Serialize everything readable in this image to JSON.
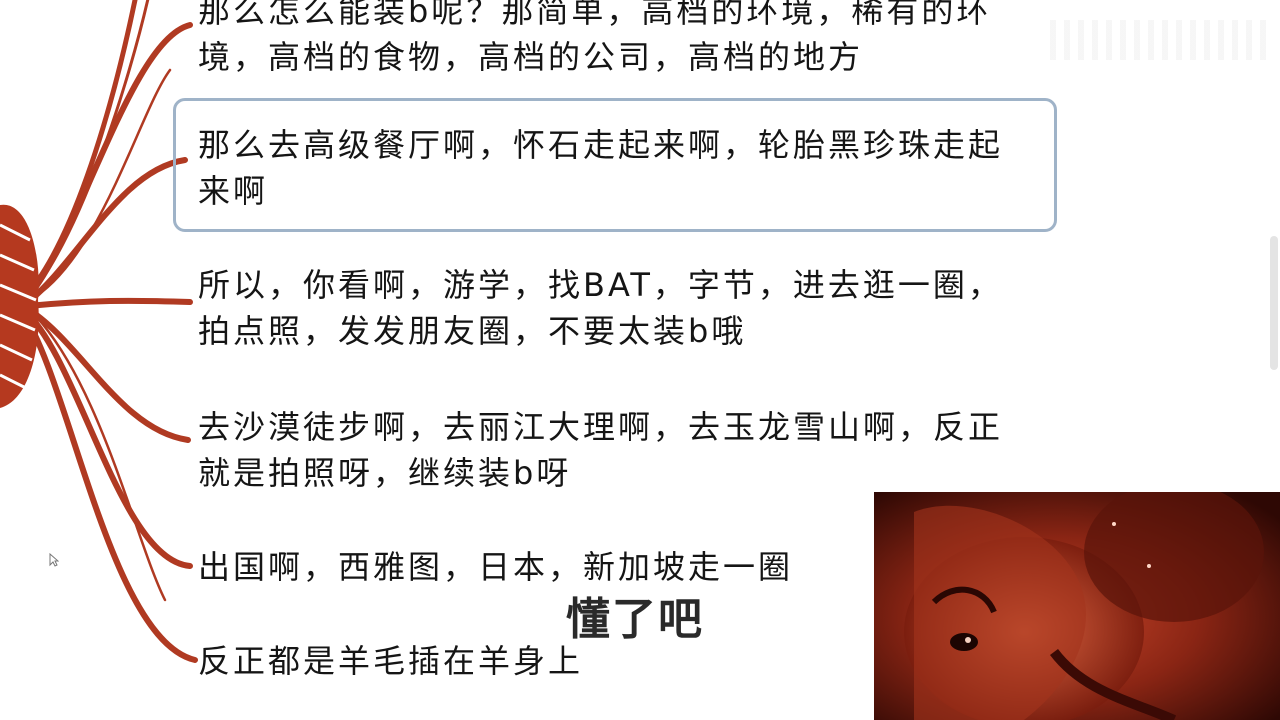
{
  "mindmap": {
    "branch_color": "#b03a22",
    "nodes": [
      {
        "text": "那么怎么能装b呢？那简单，高档的环境，稀有的环\n境，高档的食物，高档的公司，高档的地方"
      },
      {
        "text": "那么去高级餐厅啊，怀石走起来啊，轮胎黑珍珠走起\n来啊",
        "selected": true
      },
      {
        "text": "所以，你看啊，游学，找BAT，字节，进去逛一圈，\n拍点照，发发朋友圈，不要太装b哦"
      },
      {
        "text": "去沙漠徒步啊，去丽江大理啊，去玉龙雪山啊，反正\n就是拍照呀，继续装b呀"
      },
      {
        "text": "出国啊，西雅图，日本，新加坡走一圈"
      },
      {
        "text": "反正都是羊毛插在羊身上"
      }
    ]
  },
  "subtitle": {
    "text": "懂了吧"
  },
  "video_overlay": {
    "description_icon": "presenter-video-icon"
  },
  "colors": {
    "selection_border": "#9fb3c8",
    "text": "#151515"
  }
}
